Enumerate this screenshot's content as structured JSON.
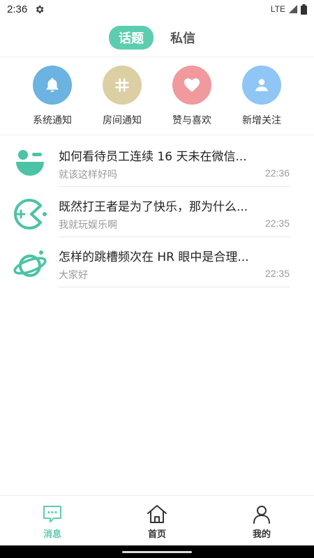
{
  "status_bar": {
    "time": "2:36",
    "network": "LTE"
  },
  "header": {
    "tabs": [
      {
        "label": "话题",
        "active": true
      },
      {
        "label": "私信",
        "active": false
      }
    ]
  },
  "categories": [
    {
      "label": "系统通知",
      "icon": "bell-icon",
      "color": "#6bb3e0"
    },
    {
      "label": "房间通知",
      "icon": "hash-icon",
      "color": "#dccfa3"
    },
    {
      "label": "赞与喜欢",
      "icon": "heart-icon",
      "color": "#f09a9e"
    },
    {
      "label": "新增关注",
      "icon": "user-icon",
      "color": "#8fc6f5"
    }
  ],
  "messages": [
    {
      "title": "如何看待员工连续 16 天未在微信...",
      "subtitle": "就该这样好吗",
      "time": "22:36",
      "icon": "smile-bowl-icon"
    },
    {
      "title": "既然打王者是为了快乐，那为什么...",
      "subtitle": "我就玩娱乐啊",
      "time": "22:35",
      "icon": "pacman-icon"
    },
    {
      "title": "怎样的跳槽频次在 HR 眼中是合理...",
      "subtitle": "大家好",
      "time": "22:35",
      "icon": "planet-icon"
    }
  ],
  "bottom_nav": [
    {
      "label": "消息",
      "icon": "chat-icon",
      "active": true
    },
    {
      "label": "首页",
      "icon": "home-icon",
      "active": false
    },
    {
      "label": "我的",
      "icon": "profile-icon",
      "active": false
    }
  ],
  "colors": {
    "accent": "#5dcdb0"
  }
}
